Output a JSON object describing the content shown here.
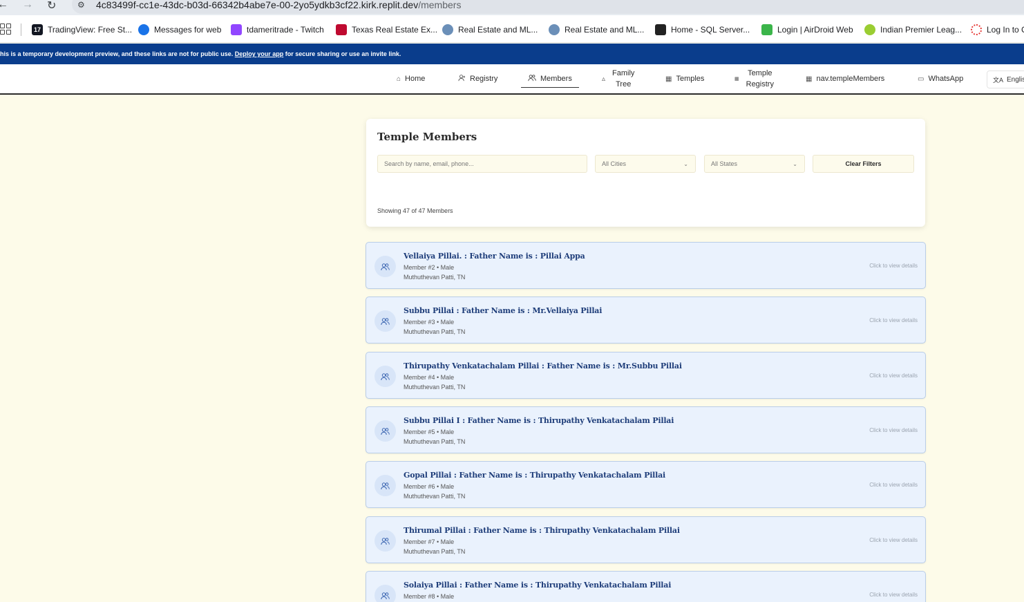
{
  "browser": {
    "url_host": "4c83499f-cc1e-43dc-b03d-66342b4abe7e-00-2yo5ydkb3cf22.kirk.replit.dev",
    "url_path": "/members",
    "bookmarks": [
      {
        "label": "TradingView: Free St...",
        "icon": "tradingview-icon",
        "color": "#131722",
        "glyph": "17"
      },
      {
        "label": "Messages for web",
        "icon": "messages-icon",
        "color": "#1a73e8",
        "glyph": ""
      },
      {
        "label": "tdameritrade - Twitch",
        "icon": "twitch-icon",
        "color": "#9146ff",
        "glyph": ""
      },
      {
        "label": "Texas Real Estate Ex...",
        "icon": "texas-flag-icon",
        "color": "#bf0a30",
        "glyph": ""
      },
      {
        "label": "Real Estate and ML...",
        "icon": "globe-icon",
        "color": "#6b8fb8",
        "glyph": ""
      },
      {
        "label": "Real Estate and ML...",
        "icon": "globe-icon",
        "color": "#6b8fb8",
        "glyph": ""
      },
      {
        "label": "Home - SQL Server...",
        "icon": "chart-icon",
        "color": "#222222",
        "glyph": ""
      },
      {
        "label": "Login | AirDroid Web",
        "icon": "airdroid-icon",
        "color": "#3bb54a",
        "glyph": ""
      },
      {
        "label": "Indian Premier Leag...",
        "icon": "ball-icon",
        "color": "#9acd32",
        "glyph": ""
      },
      {
        "label": "Log In to C",
        "icon": "circle-dots-icon",
        "color": "#e53935",
        "glyph": ""
      }
    ]
  },
  "banner": {
    "text_before": "his is a temporary development preview, and these links are not for public use. ",
    "link": "Deploy your app",
    "text_after": " for secure sharing or use an invite link."
  },
  "nav": {
    "items": [
      {
        "label": "Home",
        "icon": "home-icon"
      },
      {
        "label": "Registry",
        "icon": "user-add-icon"
      },
      {
        "label": "Members",
        "icon": "users-icon"
      },
      {
        "label_line1": "Family",
        "label_line2": "Tree",
        "icon": "tree-icon"
      },
      {
        "label": "Temples",
        "icon": "building-icon"
      },
      {
        "label_line1": "Temple",
        "label_line2": "Registry",
        "icon": "building-icon"
      },
      {
        "label": "nav.templeMembers",
        "icon": "building-icon"
      },
      {
        "label": "WhatsApp",
        "icon": "chat-icon"
      }
    ],
    "active": "Members",
    "language": "Englisl"
  },
  "filters": {
    "title": "Temple Members",
    "search_placeholder": "Search by name, email, phone...",
    "city_value": "All Cities",
    "state_value": "All States",
    "clear_label": "Clear Filters",
    "showing": "Showing 47 of 47 Members"
  },
  "members": [
    {
      "name": "Vellaiya Pillai. : Father Name is : Pillai Appa",
      "meta": "Member #2 • Male",
      "location": "Muthuthevan Patti, TN",
      "action": "Click to view details"
    },
    {
      "name": "Subbu Pillai : Father Name is : Mr.Vellaiya Pillai",
      "meta": "Member #3 • Male",
      "location": "Muthuthevan Patti, TN",
      "action": "Click to view details"
    },
    {
      "name": "Thirupathy Venkatachalam Pillai : Father Name is : Mr.Subbu Pillai",
      "meta": "Member #4 • Male",
      "location": "Muthuthevan Patti, TN",
      "action": "Click to view details"
    },
    {
      "name": "Subbu Pillai I : Father Name is : Thirupathy Venkatachalam Pillai",
      "meta": "Member #5 • Male",
      "location": "Muthuthevan Patti, TN",
      "action": "Click to view details"
    },
    {
      "name": "Gopal Pillai : Father Name is : Thirupathy Venkatachalam Pillai",
      "meta": "Member #6 • Male",
      "location": "Muthuthevan Patti, TN",
      "action": "Click to view details"
    },
    {
      "name": "Thirumal Pillai : Father Name is : Thirupathy Venkatachalam Pillai",
      "meta": "Member #7 • Male",
      "location": "Muthuthevan Patti, TN",
      "action": "Click to view details"
    },
    {
      "name": "Solaiya Pillai : Father Name is : Thirupathy Venkatachalam Pillai",
      "meta": "Member #8 • Male",
      "location": "",
      "action": "Click to view details"
    }
  ]
}
